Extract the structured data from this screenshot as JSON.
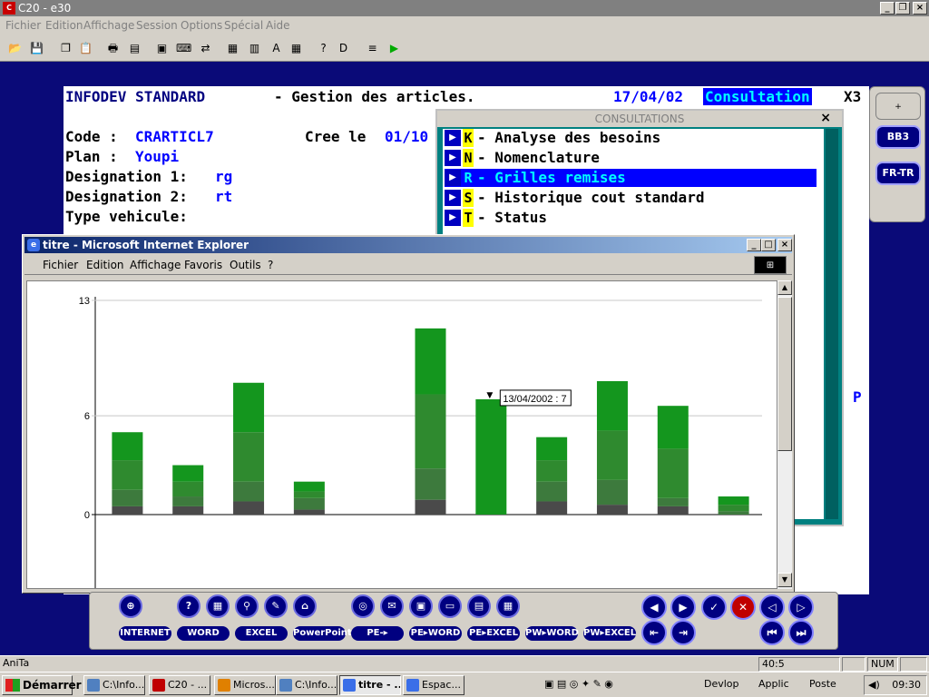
{
  "app": {
    "title": "C20 -  e30",
    "menu": [
      "Fichier",
      "Edition",
      "Affichage",
      "Session",
      "Options",
      "Spécial",
      "Aide"
    ]
  },
  "terminal": {
    "header_left": "INFODEV STANDARD",
    "header_title": "- Gestion des articles.",
    "header_date": "17/04/02",
    "header_mode": "Consultation",
    "header_code": "X3",
    "code_label": "Code :",
    "code_value": "CRARTICL7",
    "cree_label": "Cree le",
    "cree_value": "01/10",
    "plan_label": "Plan :",
    "plan_value": "Youpi",
    "des1_label": "Designation 1:",
    "des1_value": "rg",
    "des2_label": "Designation 2:",
    "des2_value": "rt",
    "type_label": "Type vehicule:",
    "right_marker": "P"
  },
  "side_buttons": {
    "plus": "+",
    "b1": "BB3",
    "b2": "FR-TR"
  },
  "consultations": {
    "title": "CONSULTATIONS",
    "close": "×",
    "items": [
      {
        "key": "K",
        "label": "- Analyse des besoins"
      },
      {
        "key": "N",
        "label": "- Nomenclature"
      },
      {
        "key": "R",
        "label": "- Grilles remises"
      },
      {
        "key": "S",
        "label": "- Historique cout standard"
      },
      {
        "key": "T",
        "label": "- Status"
      }
    ]
  },
  "ie": {
    "title": "titre - Microsoft Internet Explorer",
    "menu": [
      "Fichier",
      "Edition",
      "Affichage",
      "Favoris",
      "Outils",
      "?"
    ]
  },
  "chart_data": {
    "type": "bar",
    "ylim": [
      0,
      13
    ],
    "yticks": [
      "13",
      "6",
      "0"
    ],
    "yticks_values": [
      13,
      6,
      0
    ],
    "categories": [
      "",
      "",
      "",
      "",
      "",
      "",
      "",
      "",
      "",
      "",
      ""
    ],
    "series_colors": [
      "#4a4a4a",
      "#3d7a3d",
      "#2f8a2f",
      "#14961e"
    ],
    "stacks": [
      [
        0.5,
        1.0,
        1.8,
        1.7
      ],
      [
        0.5,
        0.6,
        0.9,
        1.0
      ],
      [
        0.8,
        1.2,
        3.0,
        3.0
      ],
      [
        0.3,
        0.7,
        0.4,
        0.6
      ],
      [
        0,
        0,
        0,
        0
      ],
      [
        0.9,
        1.9,
        4.5,
        4.0
      ],
      [
        0,
        0,
        0,
        7
      ],
      [
        0.8,
        1.2,
        1.3,
        1.4
      ],
      [
        0.6,
        1.5,
        3.0,
        3.0
      ],
      [
        0.5,
        0.5,
        3.0,
        2.6
      ],
      [
        0,
        0.2,
        0.4,
        0.5
      ]
    ],
    "tooltip": "13/04/2002 : 7",
    "tooltip_index": 6
  },
  "dock": {
    "labels": [
      "INTERNET",
      "WORD",
      "EXCEL",
      "PowerPoint",
      "PE-▸",
      "PE▸WORD",
      "PE▸EXCEL",
      "PW▸WORD",
      "PW▸EXCEL"
    ]
  },
  "status": {
    "left": "AniTa",
    "pos": "40:5",
    "num": "NUM"
  },
  "taskbar": {
    "start": "Démarrer",
    "tasks": [
      "C:\\Info...",
      "C20 - ...",
      "Micros...",
      "C:\\Info...",
      "titre - ...",
      "Espac..."
    ],
    "devlop": "Devlop",
    "applic": "Applic",
    "poste": "Poste",
    "clock": "09:30"
  }
}
